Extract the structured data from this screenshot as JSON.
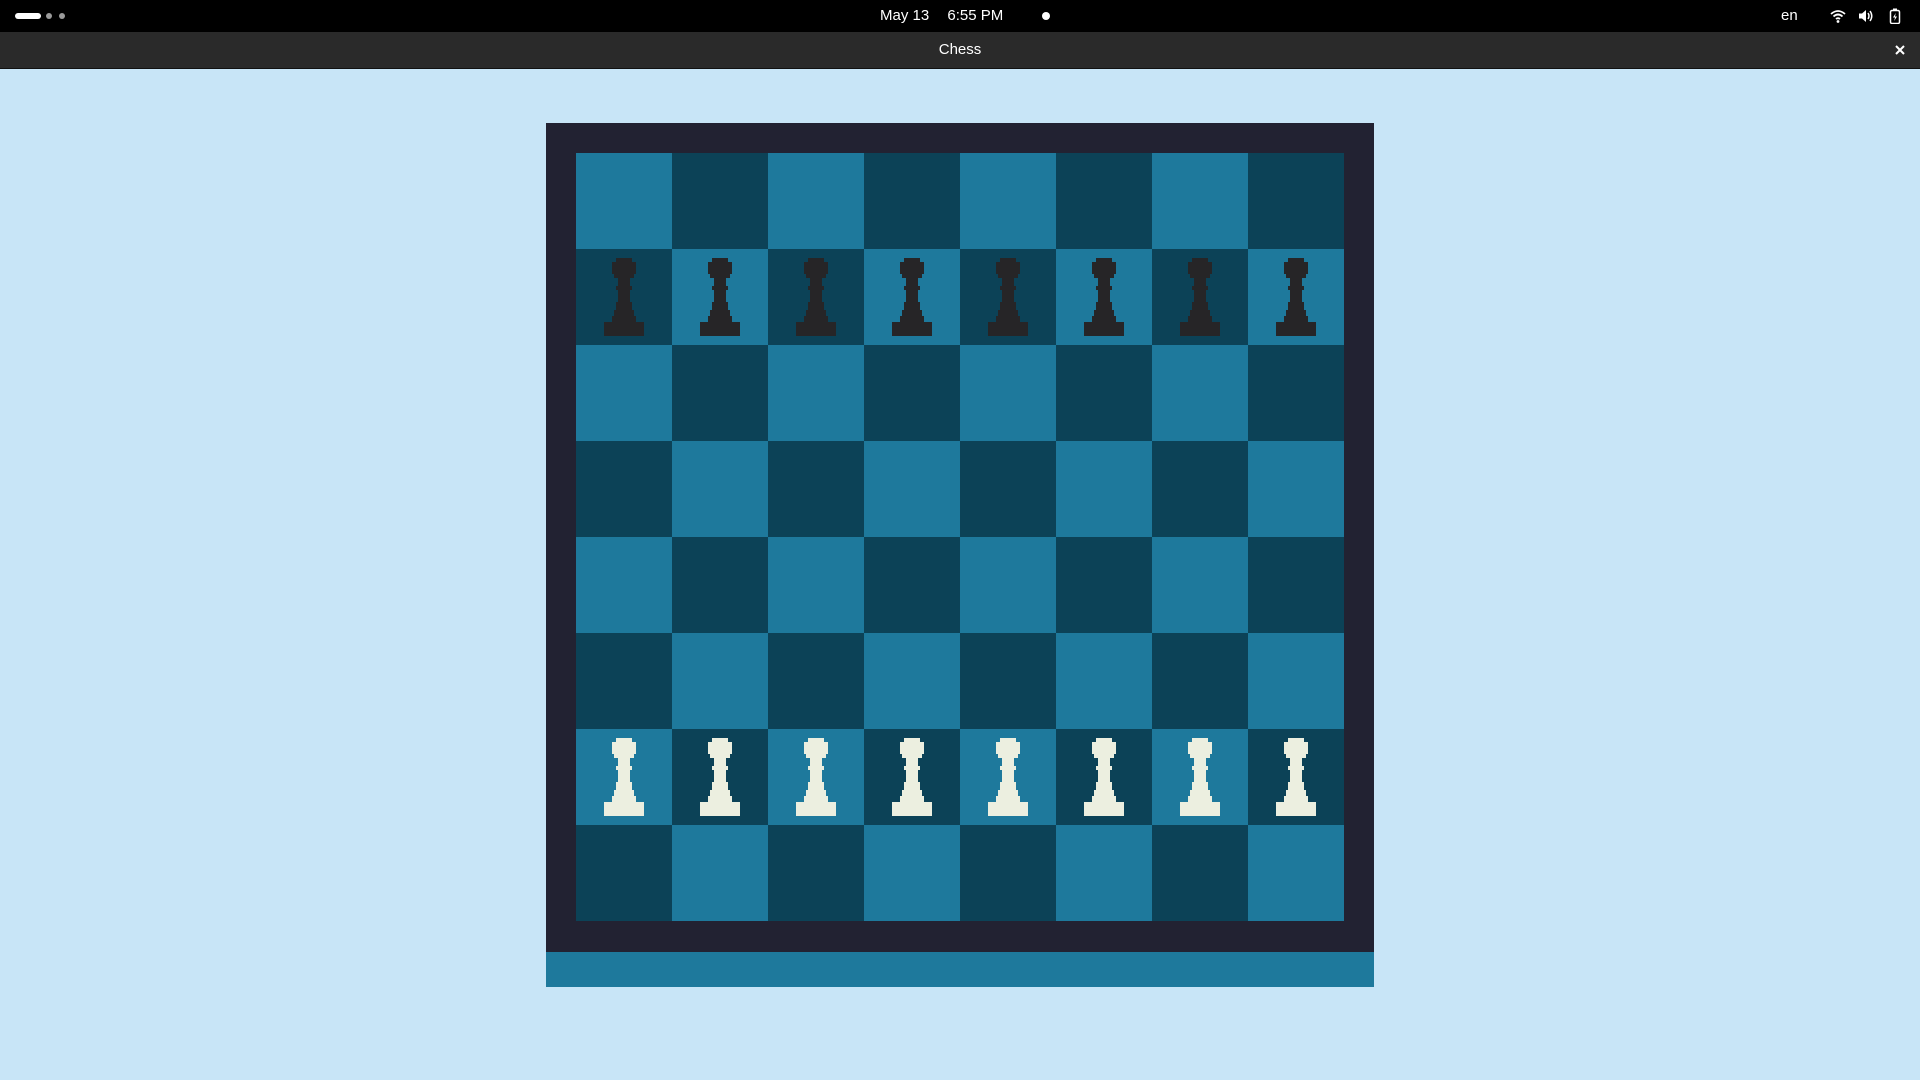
{
  "topbar": {
    "date": "May 13",
    "time": "6:55 PM",
    "language": "en",
    "icons": [
      "wifi-icon",
      "volume-icon",
      "battery-icon"
    ]
  },
  "window": {
    "title": "Chess",
    "close_label": "×"
  },
  "colors": {
    "background": "#c8e5f7",
    "board_frame": "#222232",
    "light_square": "#1e799c",
    "dark_square": "#0c4257",
    "black_piece": "#262527",
    "white_piece": "#ecefe0",
    "status_strip": "#1e799c"
  },
  "board": {
    "ranks": [
      [
        "",
        "",
        "",
        "",
        "",
        "",
        "",
        ""
      ],
      [
        "bp",
        "bp",
        "bp",
        "bp",
        "bp",
        "bp",
        "bp",
        "bp"
      ],
      [
        "",
        "",
        "",
        "",
        "",
        "",
        "",
        ""
      ],
      [
        "",
        "",
        "",
        "",
        "",
        "",
        "",
        ""
      ],
      [
        "",
        "",
        "",
        "",
        "",
        "",
        "",
        ""
      ],
      [
        "",
        "",
        "",
        "",
        "",
        "",
        "",
        ""
      ],
      [
        "wp",
        "wp",
        "wp",
        "wp",
        "wp",
        "wp",
        "wp",
        "wp"
      ],
      [
        "",
        "",
        "",
        "",
        "",
        "",
        "",
        ""
      ]
    ]
  }
}
